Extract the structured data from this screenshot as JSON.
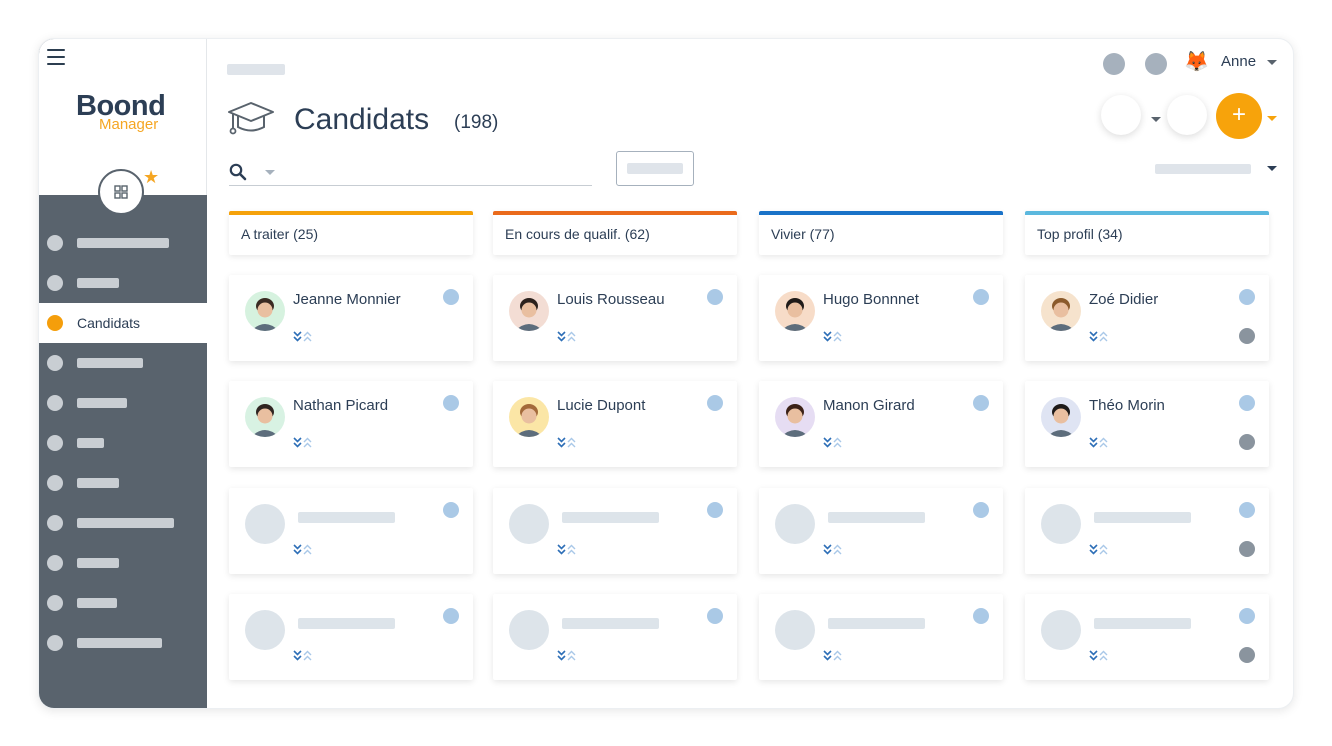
{
  "app": {
    "logo_main": "Boond",
    "logo_sub": "Manager"
  },
  "sidebar": {
    "active_label": "Candidats"
  },
  "header": {
    "user_name": "Anne",
    "add_label": "+"
  },
  "page": {
    "title": "Candidats",
    "count": "(198)"
  },
  "columns": [
    {
      "label": "A traiter (25)",
      "color": "#f5a20b",
      "cards": [
        "Jeanne Monnier",
        "Nathan Picard"
      ]
    },
    {
      "label": "En cours de qualif. (62)",
      "color": "#ea6a1b",
      "cards": [
        "Louis Rousseau",
        "Lucie Dupont"
      ]
    },
    {
      "label": "Vivier (77)",
      "color": "#1a73c8",
      "cards": [
        "Hugo Bonnnet",
        "Manon Girard"
      ]
    },
    {
      "label": "Top profil (34)",
      "color": "#5bb8de",
      "cards": [
        "Zoé Didier",
        "Théo Morin"
      ]
    }
  ],
  "colors": {
    "accent": "#f7a30b",
    "sidebar_bg": "#59636d",
    "text": "#2c3e55",
    "status_dot": "#aac9e6"
  },
  "icons": [
    "hamburger-icon",
    "apps-grid-icon",
    "sparkle-star-icon",
    "graduation-cap-icon",
    "search-icon",
    "fox-avatar-icon",
    "double-chevron-icon"
  ]
}
